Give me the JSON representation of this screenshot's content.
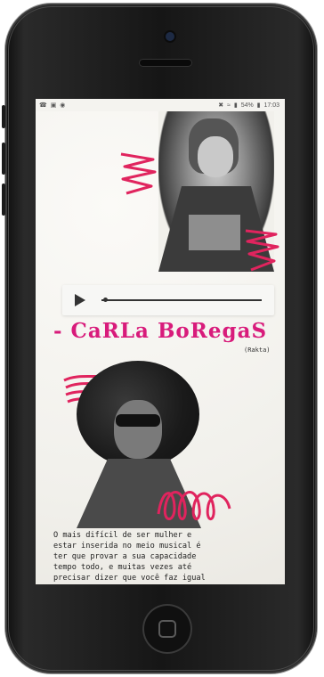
{
  "status_bar": {
    "left_icons": [
      "whatsapp-icon",
      "image-icon",
      "instagram-icon"
    ],
    "battery": "54%",
    "time": "17:03"
  },
  "audio_player": {
    "progress": 0.02
  },
  "artist": {
    "name": "- CaRLa BoRegaS",
    "band": "(Rakta)"
  },
  "quote": {
    "lines": [
      "O mais difícil de ser mulher e",
      "estar inserida no meio musical é",
      "ter que provar a sua capacidade",
      "tempo todo, e muitas vezes até",
      "precisar dizer que você faz igual"
    ]
  },
  "colors": {
    "accent": "#d81b7b",
    "text": "#222222",
    "paper": "#f4f3ef"
  }
}
